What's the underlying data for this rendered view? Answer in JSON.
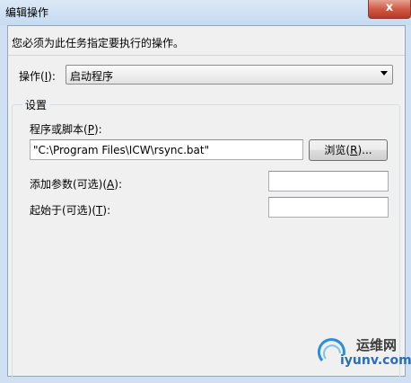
{
  "window": {
    "title": "编辑操作",
    "close_glyph": "x"
  },
  "instruction": "您必须为此任务指定要执行的操作。",
  "action": {
    "label_pre": "操作(",
    "label_key": "I",
    "label_post": "):",
    "selected": "启动程序"
  },
  "settings": {
    "group_title": "设置",
    "program": {
      "label_pre": "程序或脚本(",
      "label_key": "P",
      "label_post": "):",
      "value": "\"C:\\Program Files\\ICW\\rsync.bat\""
    },
    "browse": {
      "label_pre": "浏览(",
      "label_key": "R",
      "label_post": ")..."
    },
    "arguments": {
      "label_pre": "添加参数(可选)(",
      "label_key": "A",
      "label_post": "):",
      "value": ""
    },
    "start_in": {
      "label_pre": "起始于(可选)(",
      "label_key": "T",
      "label_post": "):",
      "value": ""
    }
  },
  "watermark": {
    "cn": "运维网",
    "en": "iyunv.com"
  }
}
